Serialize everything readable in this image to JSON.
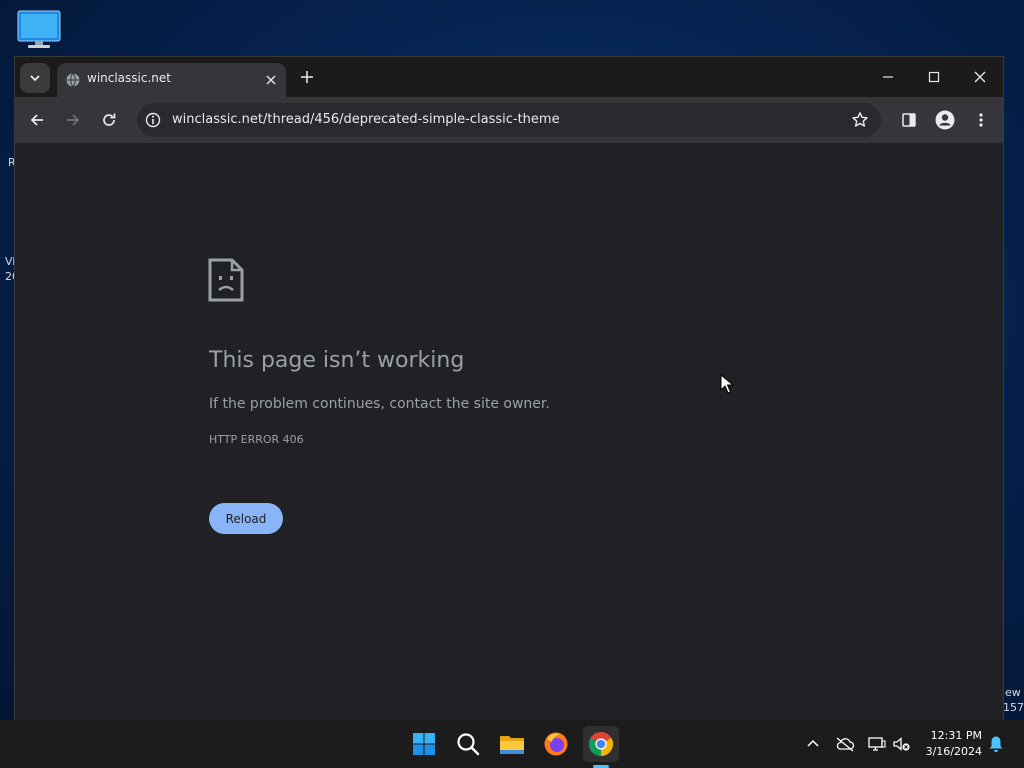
{
  "desktop": {
    "fragments": [
      "R",
      "Vi",
      "20",
      "ew",
      "157"
    ]
  },
  "browser": {
    "tab": {
      "title": "winclassic.net"
    },
    "address": {
      "url": "winclassic.net/thread/456/deprecated-simple-classic-theme"
    },
    "error": {
      "title": "This page isn’t working",
      "description": "If the problem continues, contact the site owner.",
      "code": "HTTP ERROR 406",
      "reload_label": "Reload"
    }
  },
  "taskbar": {
    "apps": [
      "start-icon",
      "search-icon",
      "file-explorer-icon",
      "firefox-icon",
      "chrome-icon"
    ],
    "clock": {
      "time": "12:31 PM",
      "date": "3/16/2024"
    }
  },
  "colors": {
    "accent": "#8ab4f8",
    "page_bg": "#202124",
    "toolbar_bg": "#35363a",
    "titlebar_bg": "#1b1b1b",
    "taskbar_bg": "#1c1c1c",
    "text_muted": "#9aa0a6"
  }
}
